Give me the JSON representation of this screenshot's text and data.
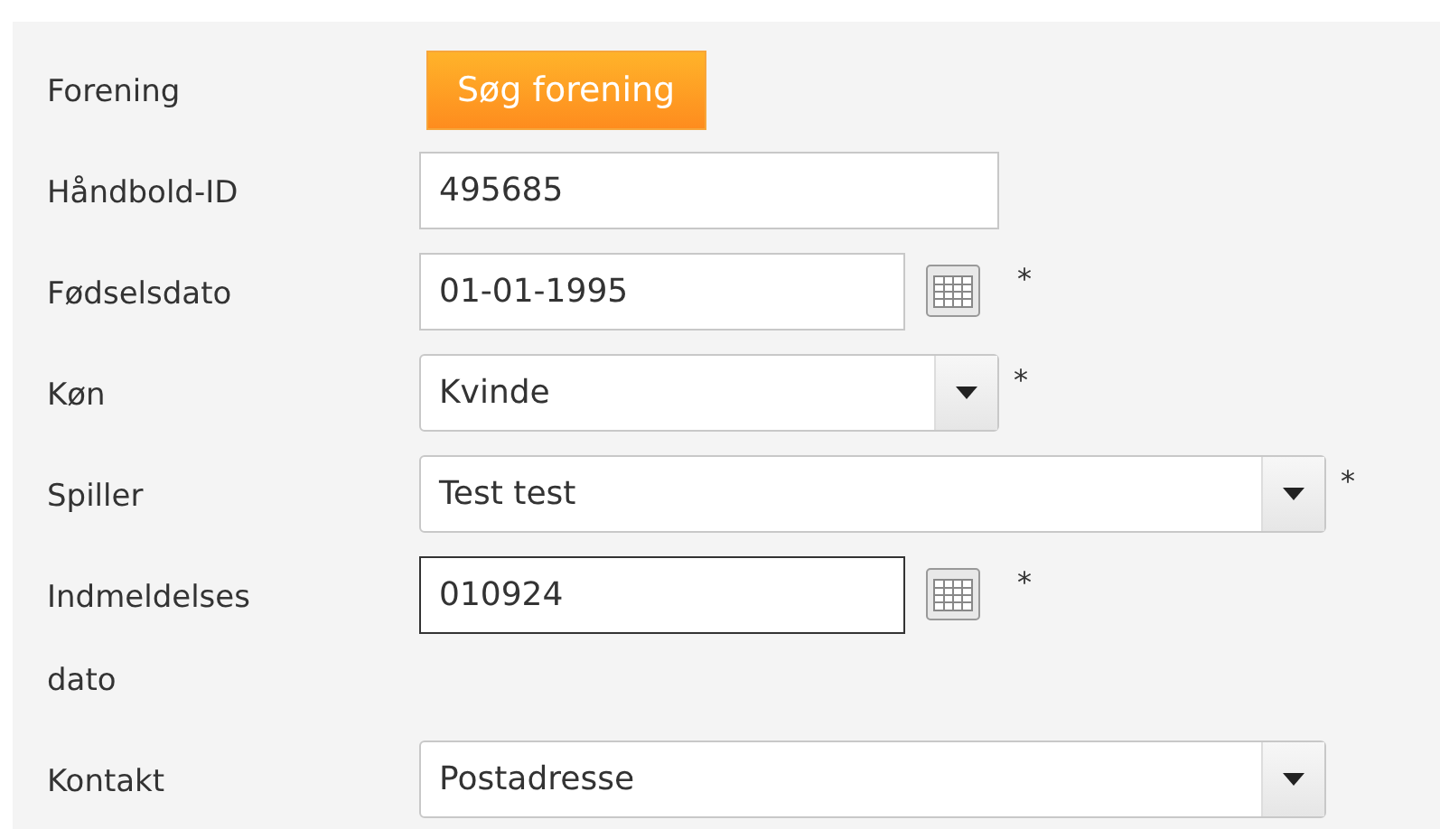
{
  "rows": [
    {
      "label": "Forening",
      "kind": "button",
      "button": "Søg forening"
    },
    {
      "label": "Håndbold-ID",
      "kind": "text",
      "value": "495685",
      "focused": false
    },
    {
      "label": "Fødselsdato",
      "kind": "date",
      "value": "01-01-1995",
      "focused": false,
      "required_mark": "*"
    },
    {
      "label": "Køn",
      "kind": "select",
      "value": "Kvinde",
      "wide": false,
      "required_mark": "*"
    },
    {
      "label": "Spiller",
      "kind": "select",
      "value": "Test test",
      "wide": true,
      "required_mark": "*"
    },
    {
      "label": "Indmeldelses dato",
      "kind": "date",
      "value": "010924",
      "focused": true,
      "required_mark": "*"
    },
    {
      "label": "Kontakt",
      "kind": "select",
      "value": "Postadresse",
      "wide": true
    }
  ]
}
